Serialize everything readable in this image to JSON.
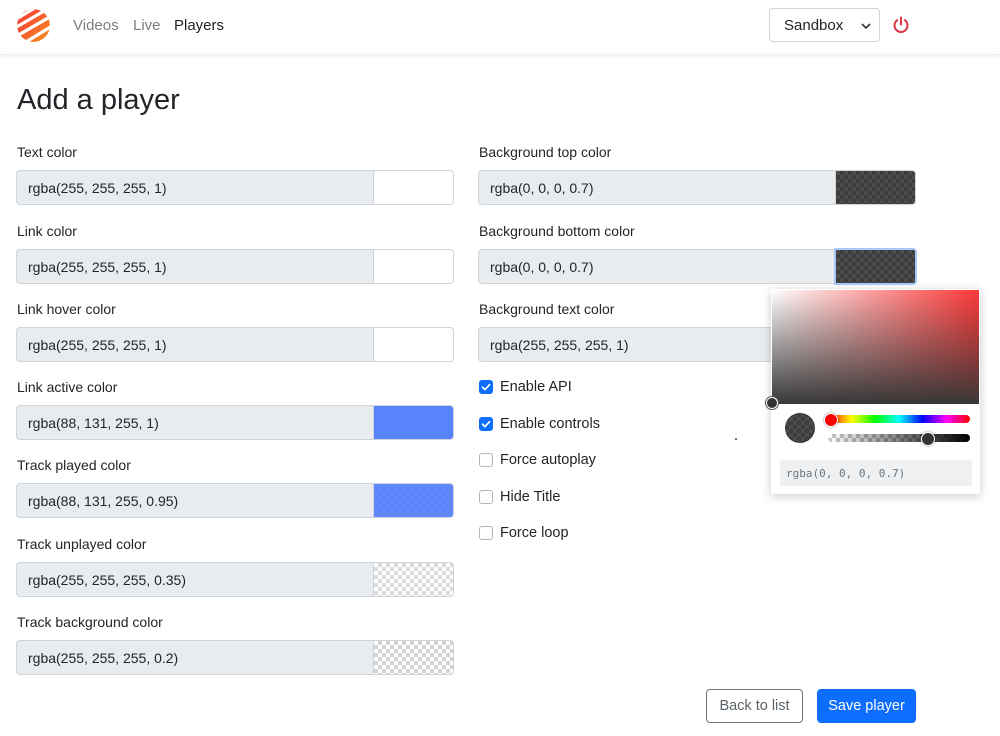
{
  "nav": {
    "links": [
      "Videos",
      "Live",
      "Players"
    ],
    "active": "Players",
    "environment": "Sandbox"
  },
  "page": {
    "title": "Add a player"
  },
  "left_fields": [
    {
      "label": "Text color",
      "value": "rgba(255, 255, 255, 1)",
      "swatch": "rgba(255, 255, 255, 1)"
    },
    {
      "label": "Link color",
      "value": "rgba(255, 255, 255, 1)",
      "swatch": "rgba(255, 255, 255, 1)"
    },
    {
      "label": "Link hover color",
      "value": "rgba(255, 255, 255, 1)",
      "swatch": "rgba(255, 255, 255, 1)"
    },
    {
      "label": "Link active color",
      "value": "rgba(88, 131, 255, 1)",
      "swatch": "rgba(88, 131, 255, 1)"
    },
    {
      "label": "Track played color",
      "value": "rgba(88, 131, 255, 0.95)",
      "swatch": "rgba(88, 131, 255, 0.95)"
    },
    {
      "label": "Track unplayed color",
      "value": "rgba(255, 255, 255, 0.35)",
      "swatch": "rgba(255, 255, 255, 0.35)"
    },
    {
      "label": "Track background color",
      "value": "rgba(255, 255, 255, 0.2)",
      "swatch": "rgba(255, 255, 255, 0.2)"
    }
  ],
  "right_fields": [
    {
      "label": "Background top color",
      "value": "rgba(0, 0, 0, 0.7)",
      "swatch": "rgba(0, 0, 0, 0.7)"
    },
    {
      "label": "Background bottom color",
      "value": "rgba(0, 0, 0, 0.7)",
      "swatch": "rgba(0, 0, 0, 0.7)"
    },
    {
      "label": "Background text color",
      "value": "rgba(255, 255, 255, 1)",
      "swatch": "rgba(255, 255, 255, 1)"
    }
  ],
  "checkboxes": [
    {
      "label": "Enable API",
      "checked": true
    },
    {
      "label": "Enable controls",
      "checked": true
    },
    {
      "label": "Force autoplay",
      "checked": false
    },
    {
      "label": "Hide Title",
      "checked": false
    },
    {
      "label": "Force loop",
      "checked": false
    }
  ],
  "color_picker": {
    "value": "rgba(0, 0, 0, 0.7)",
    "hue_color": "#ff0000",
    "alpha": 0.7
  },
  "buttons": {
    "back": "Back to list",
    "save": "Save player"
  },
  "colors": {
    "primary": "#0d6efd",
    "danger": "#dc3545",
    "logo": "#f05a28"
  }
}
